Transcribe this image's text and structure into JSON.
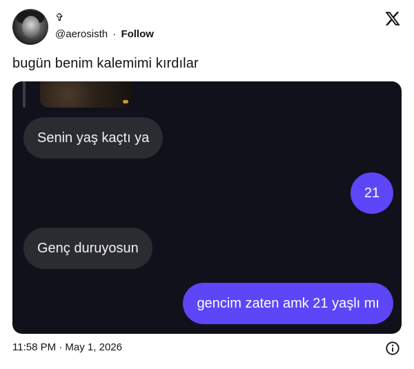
{
  "author": {
    "display_name": "✞",
    "handle": "@aerosisth",
    "separator": "·",
    "follow_label": "Follow"
  },
  "brand": {
    "icon": "x-logo-icon"
  },
  "tweet": {
    "text": "bugün benim kalemimi kırdılar"
  },
  "chat": {
    "messages": [
      {
        "side": "received",
        "text": "Senin yaş kaçtı ya"
      },
      {
        "side": "sent",
        "text": "21"
      },
      {
        "side": "received",
        "text": "Genç duruyosun"
      },
      {
        "side": "sent",
        "text": "gencim zaten amk 21 yaşlı mı"
      }
    ],
    "colors": {
      "background": "#10111a",
      "received": "#2b2c31",
      "sent": "#5d45f8"
    }
  },
  "footer": {
    "timestamp": "11:58 PM · May 1, 2026",
    "info_icon": "info-icon"
  }
}
